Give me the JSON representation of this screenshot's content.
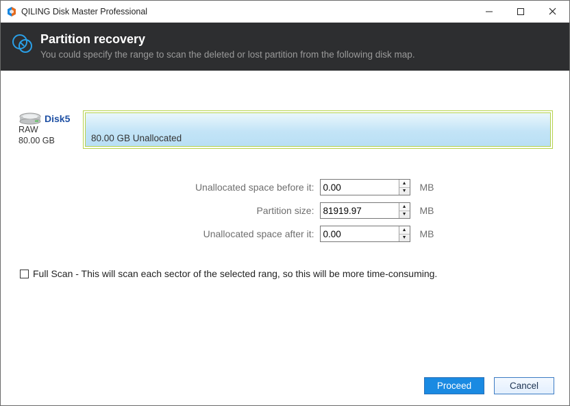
{
  "titlebar": {
    "title": "QILING Disk Master Professional"
  },
  "header": {
    "title": "Partition recovery",
    "subtitle": "You could specify the range to scan the deleted or lost partition from the following disk map."
  },
  "disk": {
    "name": "Disk5",
    "fs": "RAW",
    "size": "80.00 GB",
    "segment_label": "80.00 GB Unallocated"
  },
  "form": {
    "before_label": "Unallocated space before it:",
    "before_value": "0.00",
    "size_label": "Partition size:",
    "size_value": "81919.97",
    "after_label": "Unallocated space after it:",
    "after_value": "0.00",
    "unit": "MB"
  },
  "fullscan": {
    "label": "Full Scan - This will scan each sector of the selected rang, so this will be more time-consuming."
  },
  "buttons": {
    "proceed": "Proceed",
    "cancel": "Cancel"
  }
}
